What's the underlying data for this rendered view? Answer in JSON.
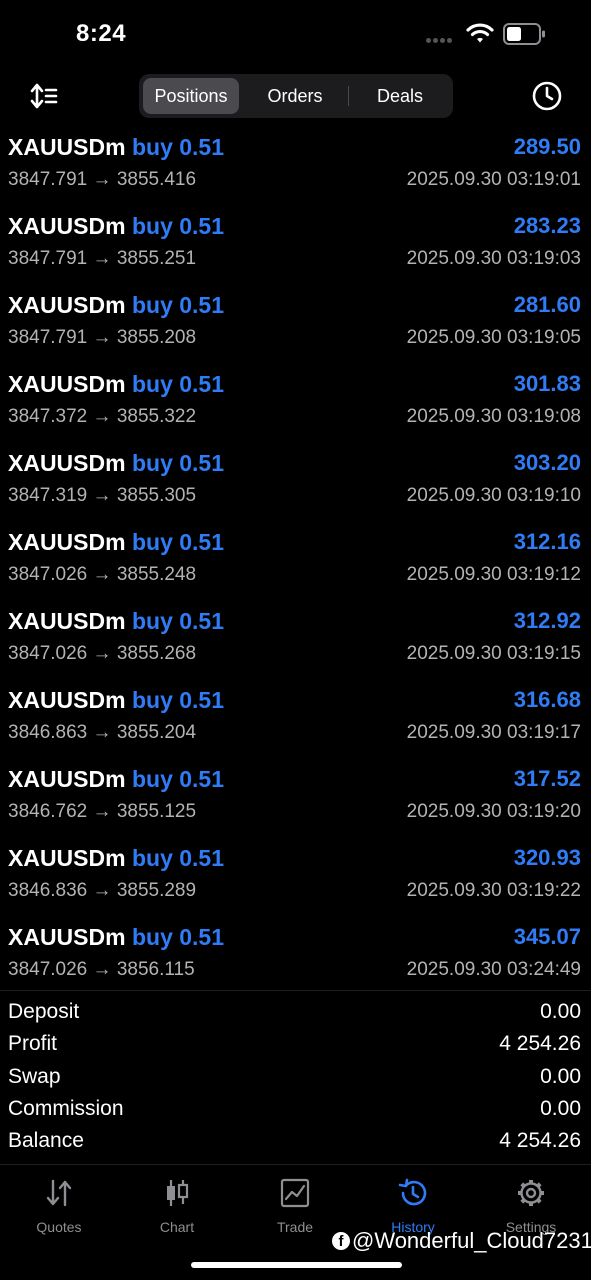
{
  "status_bar": {
    "time": "8:24"
  },
  "toolbar": {
    "tabs": [
      {
        "label": "Positions",
        "active": true
      },
      {
        "label": "Orders",
        "active": false
      },
      {
        "label": "Deals",
        "active": false
      }
    ]
  },
  "positions": [
    {
      "symbol": "XAUUSDm",
      "side": "buy 0.51",
      "profit": "289.50",
      "open": "3847.791",
      "close": "3855.416",
      "time": "2025.09.30 03:19:01"
    },
    {
      "symbol": "XAUUSDm",
      "side": "buy 0.51",
      "profit": "283.23",
      "open": "3847.791",
      "close": "3855.251",
      "time": "2025.09.30 03:19:03"
    },
    {
      "symbol": "XAUUSDm",
      "side": "buy 0.51",
      "profit": "281.60",
      "open": "3847.791",
      "close": "3855.208",
      "time": "2025.09.30 03:19:05"
    },
    {
      "symbol": "XAUUSDm",
      "side": "buy 0.51",
      "profit": "301.83",
      "open": "3847.372",
      "close": "3855.322",
      "time": "2025.09.30 03:19:08"
    },
    {
      "symbol": "XAUUSDm",
      "side": "buy 0.51",
      "profit": "303.20",
      "open": "3847.319",
      "close": "3855.305",
      "time": "2025.09.30 03:19:10"
    },
    {
      "symbol": "XAUUSDm",
      "side": "buy 0.51",
      "profit": "312.16",
      "open": "3847.026",
      "close": "3855.248",
      "time": "2025.09.30 03:19:12"
    },
    {
      "symbol": "XAUUSDm",
      "side": "buy 0.51",
      "profit": "312.92",
      "open": "3847.026",
      "close": "3855.268",
      "time": "2025.09.30 03:19:15"
    },
    {
      "symbol": "XAUUSDm",
      "side": "buy 0.51",
      "profit": "316.68",
      "open": "3846.863",
      "close": "3855.204",
      "time": "2025.09.30 03:19:17"
    },
    {
      "symbol": "XAUUSDm",
      "side": "buy 0.51",
      "profit": "317.52",
      "open": "3846.762",
      "close": "3855.125",
      "time": "2025.09.30 03:19:20"
    },
    {
      "symbol": "XAUUSDm",
      "side": "buy 0.51",
      "profit": "320.93",
      "open": "3846.836",
      "close": "3855.289",
      "time": "2025.09.30 03:19:22"
    },
    {
      "symbol": "XAUUSDm",
      "side": "buy 0.51",
      "profit": "345.07",
      "open": "3847.026",
      "close": "3856.115",
      "time": "2025.09.30 03:24:49"
    }
  ],
  "summary": [
    {
      "label": "Deposit",
      "value": "0.00"
    },
    {
      "label": "Profit",
      "value": "4 254.26"
    },
    {
      "label": "Swap",
      "value": "0.00"
    },
    {
      "label": "Commission",
      "value": "0.00"
    },
    {
      "label": "Balance",
      "value": "4 254.26"
    }
  ],
  "tabbar": {
    "quotes": "Quotes",
    "chart": "Chart",
    "trade": "Trade",
    "history": "History",
    "settings": "Settings",
    "active": "history"
  },
  "watermark": "@Wonderful_Cloud7231",
  "colors": {
    "accent": "#2f7cf6",
    "background": "#000000",
    "muted": "#b3b3b3"
  }
}
